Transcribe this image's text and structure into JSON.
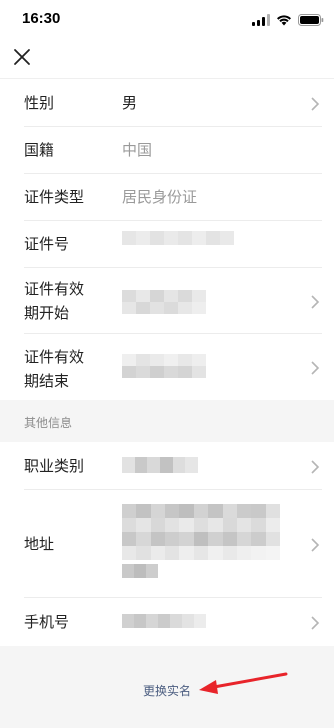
{
  "status_bar": {
    "time": "16:30",
    "icons": [
      "signal-icon",
      "wifi-icon",
      "battery-icon"
    ]
  },
  "header": {
    "close_icon": "close-icon"
  },
  "rows": [
    {
      "label": "性别",
      "value": "男",
      "value_style": "dark",
      "chevron": true
    },
    {
      "label": "国籍",
      "value": "中国",
      "value_style": "gray",
      "chevron": false
    },
    {
      "label": "证件类型",
      "value": "居民身份证",
      "value_style": "gray",
      "chevron": false
    },
    {
      "label": "证件号",
      "value": "",
      "value_style": "blurred",
      "chevron": false
    },
    {
      "label_line1": "证件有效",
      "label_line2": "期开始",
      "value": "",
      "value_style": "blurred",
      "chevron": true
    },
    {
      "label_line1": "证件有效",
      "label_line2": "期结束",
      "value": "",
      "value_style": "blurred",
      "chevron": true
    }
  ],
  "section": {
    "title": "其他信息"
  },
  "rows2": [
    {
      "label": "职业类别",
      "value": "",
      "value_style": "blurred",
      "chevron": true
    },
    {
      "label": "地址",
      "value": "",
      "value_style": "blurred",
      "chevron": true
    },
    {
      "label": "手机号",
      "value": "",
      "value_style": "blurred",
      "chevron": true
    }
  ],
  "footer": {
    "change_real_name": "更换实名"
  },
  "colors": {
    "accent_link": "#4b5d80",
    "annotation_arrow": "#e8242a",
    "background": "#f5f5f5",
    "row_bg": "#ffffff"
  }
}
